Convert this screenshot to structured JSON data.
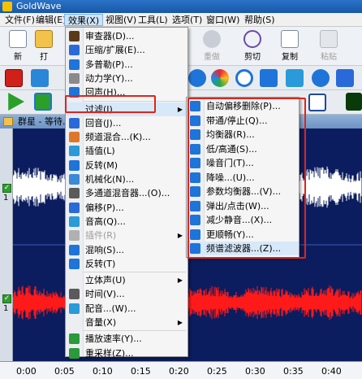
{
  "window": {
    "title": "GoldWave"
  },
  "menubar": [
    {
      "label": "文件(F)"
    },
    {
      "label": "编辑(E)"
    },
    {
      "label": "效果(X)",
      "active": true
    },
    {
      "label": "视图(V)"
    },
    {
      "label": "工具(L)"
    },
    {
      "label": "选项(T)"
    },
    {
      "label": "窗口(W)"
    },
    {
      "label": "帮助(S)"
    }
  ],
  "toolbar": {
    "new_label": "新",
    "partial_label": "打",
    "redo_label": "重做",
    "cut_label": "剪切",
    "copy_label": "复制",
    "paste_label": "粘贴"
  },
  "document": {
    "title": "群星 - 等待.m"
  },
  "ruler": {
    "ticks": [
      "0:00",
      "0:05",
      "0:10",
      "0:15",
      "0:20",
      "0:25",
      "0:30",
      "0:35",
      "0:40"
    ]
  },
  "effects_menu": {
    "items": [
      {
        "label": "审查器(D)...",
        "icon": "inspector-icon",
        "color": "#5a3a1a"
      },
      {
        "label": "压缩/扩展(E)...",
        "icon": "compressor-icon",
        "color": "#2a6ad8"
      },
      {
        "label": "多普勒(P)...",
        "icon": "doppler-icon",
        "color": "#1e74d8"
      },
      {
        "label": "动力学(Y)...",
        "icon": "dynamics-icon",
        "color": "#8a8a8a"
      },
      {
        "label": "回声(H)...",
        "icon": "echo-icon",
        "color": "#1e74d8"
      },
      {
        "label": "过滤(I)",
        "icon": "",
        "color": "",
        "submenu": true,
        "highlight": true
      },
      {
        "label": "回音(J)...",
        "icon": "reverb-icon",
        "color": "#2a6ad8"
      },
      {
        "label": "频道混合...(K)...",
        "icon": "channel-mix-icon",
        "color": "#e0762a"
      },
      {
        "label": "插值(L)",
        "icon": "interpolate-icon",
        "color": "#2a9ad8"
      },
      {
        "label": "反转(M)",
        "icon": "invert-icon",
        "color": "#1e74d8"
      },
      {
        "label": "机械化(N)...",
        "icon": "mechanize-icon",
        "color": "#3a8ad8"
      },
      {
        "label": "多通道混音器...(O)...",
        "icon": "multichannel-mixer-icon",
        "color": "#5a5a5a"
      },
      {
        "label": "偏移(P)...",
        "icon": "offset-icon",
        "color": "#2a6ad8"
      },
      {
        "label": "音高(Q)...",
        "icon": "pitch-icon",
        "color": "#2a9ad8"
      },
      {
        "label": "插件(R)",
        "icon": "plugin-icon",
        "color": "#b0b0b0",
        "disabled": true,
        "submenu": true
      },
      {
        "label": "混响(S)...",
        "icon": "reverb2-icon",
        "color": "#1e74d8"
      },
      {
        "label": "反转(T)",
        "icon": "reverse-icon",
        "color": "#1e74d8"
      },
      {
        "label": "立体声(U)",
        "icon": "",
        "color": "",
        "submenu": true
      },
      {
        "label": "时间(V)...",
        "icon": "time-icon",
        "color": "#5a5a5a"
      },
      {
        "label": "配音...(W)...",
        "icon": "voiceover-icon",
        "color": "#2a9ad8"
      },
      {
        "label": "音量(X)",
        "icon": "",
        "color": "",
        "submenu": true
      },
      {
        "label": "播放速率(Y)...",
        "icon": "playback-rate-icon",
        "color": "#2a9a3a"
      },
      {
        "label": "重采样(Z)...",
        "icon": "resample-icon",
        "color": "#2a9a3a"
      }
    ]
  },
  "filter_submenu": {
    "items": [
      {
        "label": "自动偏移删除(P)...",
        "icon": "auto-offset-icon",
        "color": "#1e74d8"
      },
      {
        "label": "带通/停止(Q)...",
        "icon": "bandpass-icon",
        "color": "#1e74d8"
      },
      {
        "label": "均衡器(R)...",
        "icon": "equalizer-icon",
        "color": "#1e74d8"
      },
      {
        "label": "低/高通(S)...",
        "icon": "lowhigh-pass-icon",
        "color": "#1e74d8"
      },
      {
        "label": "噪音门(T)...",
        "icon": "noise-gate-icon",
        "color": "#1e74d8"
      },
      {
        "label": "降噪...(U)...",
        "icon": "noise-reduction-icon",
        "color": "#1e74d8"
      },
      {
        "label": "参数均衡器...(V)...",
        "icon": "parametric-eq-icon",
        "color": "#1e74d8"
      },
      {
        "label": "弹出/点击(W)...",
        "icon": "pop-click-icon",
        "color": "#1e74d8"
      },
      {
        "label": "减少静音...(X)...",
        "icon": "reduce-silence-icon",
        "color": "#1e74d8"
      },
      {
        "label": "更顺畅(Y)...",
        "icon": "smoother-icon",
        "color": "#1e74d8"
      },
      {
        "label": "频谱滤波器...(Z)...",
        "icon": "spectrum-filter-icon",
        "color": "#1e74d8",
        "hover": true
      }
    ]
  },
  "colors": {
    "accent": "#e2231a",
    "waveform_top": "#ffffff",
    "waveform_bottom": "#ff1a1a",
    "background": "#0b1d5f"
  }
}
